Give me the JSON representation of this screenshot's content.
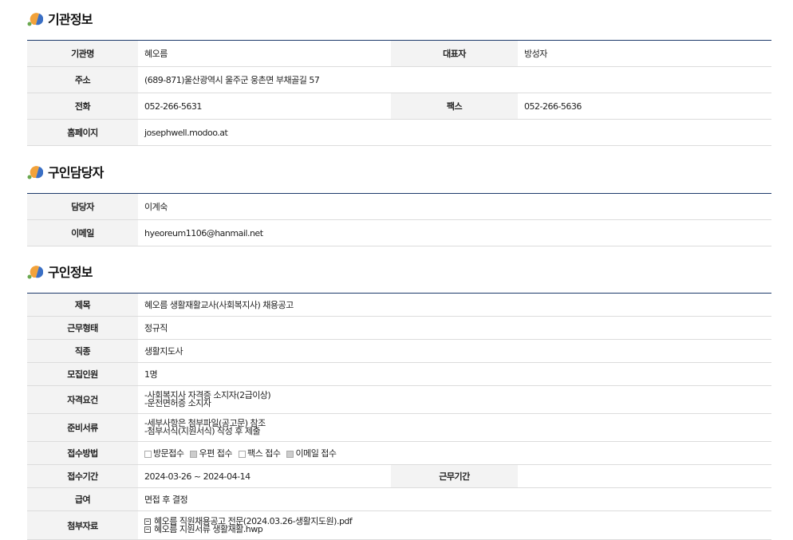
{
  "sections": {
    "org": {
      "title": "기관정보"
    },
    "contact": {
      "title": "구인담당자"
    },
    "job": {
      "title": "구인정보"
    }
  },
  "org": {
    "name_label": "기관명",
    "name": "혜오름",
    "ceo_label": "대표자",
    "ceo": "방성자",
    "address_label": "주소",
    "address": "(689-871)울산광역시 울주군 웅촌면 부채골길 57",
    "phone_label": "전화",
    "phone": "052-266-5631",
    "fax_label": "팩스",
    "fax": "052-266-5636",
    "homepage_label": "홈페이지",
    "homepage": "josephwell.modoo.at"
  },
  "contact": {
    "person_label": "담당자",
    "person": "이계숙",
    "email_label": "이메일",
    "email": "hyeoreum1106@hanmail.net"
  },
  "job": {
    "title_label": "제목",
    "title": "혜오름 생활재활교사(사회복지사) 채용공고",
    "type_label": "근무형태",
    "type": "정규직",
    "occupation_label": "직종",
    "occupation": "생활지도사",
    "headcount_label": "모집인원",
    "headcount": "1명",
    "qual_label": "자격요건",
    "qual_line1": "-사회복지사 자격증 소지자(2급이상)",
    "qual_line2": "-운전면허증 소지자",
    "docs_label": "준비서류",
    "docs_line1": "-세부사항은 첨부파일(공고문) 참조",
    "docs_line2": "-첨부서식(지원서식) 작성 후 제출",
    "method_label": "접수방법",
    "methods": [
      {
        "label": "방문접수",
        "checked": false
      },
      {
        "label": "우편 접수",
        "checked": true
      },
      {
        "label": "팩스 접수",
        "checked": false
      },
      {
        "label": "이메일 접수",
        "checked": true
      }
    ],
    "period_label": "접수기간",
    "period": "2024-03-26 ~ 2024-04-14",
    "work_period_label": "근무기간",
    "work_period": "",
    "salary_label": "급여",
    "salary": "면접 후 결정",
    "attach_label": "첨부자료",
    "attachments": [
      "혜오름 직원채용공고 전문(2024.03.26-생활지도원).pdf",
      "혜오름 지원서류 생활재활.hwp"
    ]
  },
  "colors": {
    "header_border": "#1d3a6b",
    "label_bg": "#f3f3f3",
    "row_border": "#dcdcdc"
  }
}
